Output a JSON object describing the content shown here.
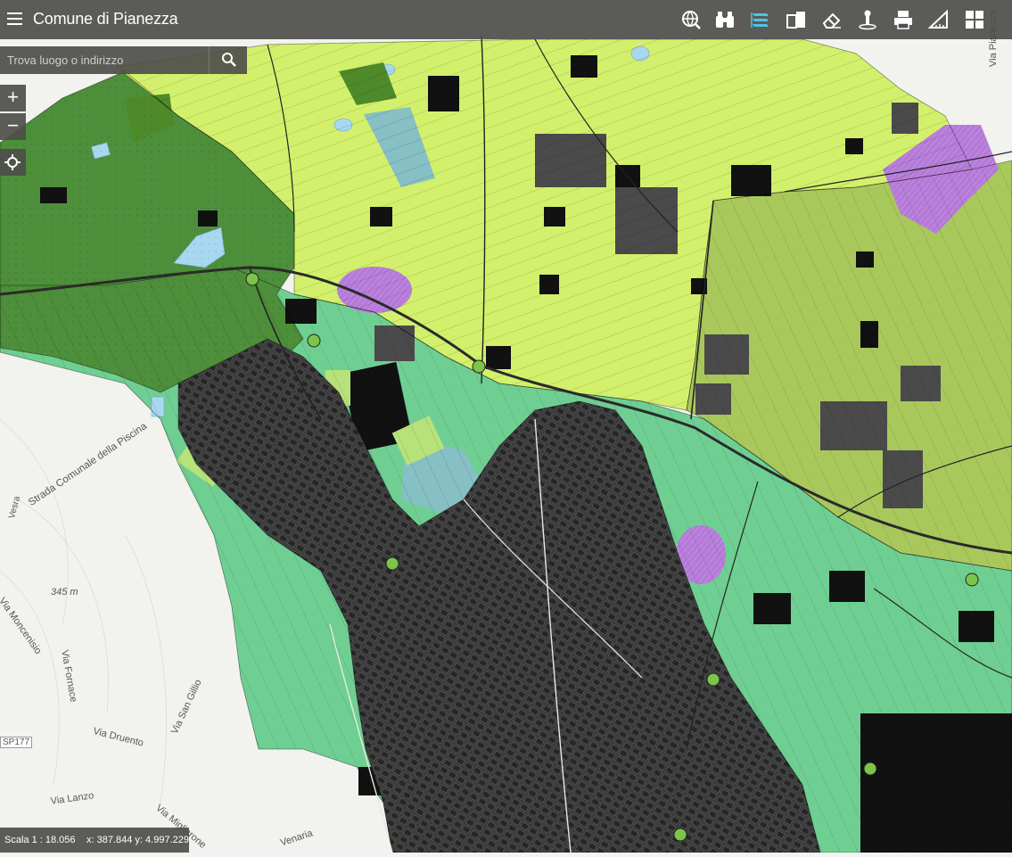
{
  "app": {
    "title": "Comune di Pianezza"
  },
  "toolbar": {
    "tools": [
      {
        "icon": "globe-search-icon"
      },
      {
        "icon": "binoculars-icon"
      },
      {
        "icon": "layers-icon",
        "active": true
      },
      {
        "icon": "compare-icon"
      },
      {
        "icon": "eraser-icon"
      },
      {
        "icon": "pin-icon"
      },
      {
        "icon": "print-icon"
      },
      {
        "icon": "measure-icon"
      },
      {
        "icon": "basemap-grid-icon"
      }
    ],
    "active_color": "#4fc3e8"
  },
  "search": {
    "placeholder": "Trova luogo o indirizzo"
  },
  "zoom": {
    "in_label": "+",
    "out_label": "−"
  },
  "status": {
    "scale": "Scala 1 : 18.056",
    "coords": "x: 387.844 y: 4.997.229"
  },
  "map": {
    "place_labels": [
      "Strada Comunale della Piscina",
      "345 m",
      "Via Moncenisio",
      "Via Fornace",
      "Via San Gillio",
      "Via Druento",
      "SP177",
      "Via Lanzo",
      "Via Migliarone",
      "Venaria",
      "Via Pianezza",
      "Vesra"
    ],
    "colors": {
      "agricultural_light": "#d3f06c",
      "agricultural_olive": "#a9c85c",
      "green_medium": "#6fcf93",
      "green_dark": "#4d8f3a",
      "urban_dark": "#3a3a3a",
      "building_black": "#111111",
      "services_blue": "#86bfc4",
      "special_purple": "#b57ad8",
      "water": "#a8d8f0",
      "base_land": "#f3f3f1"
    }
  }
}
